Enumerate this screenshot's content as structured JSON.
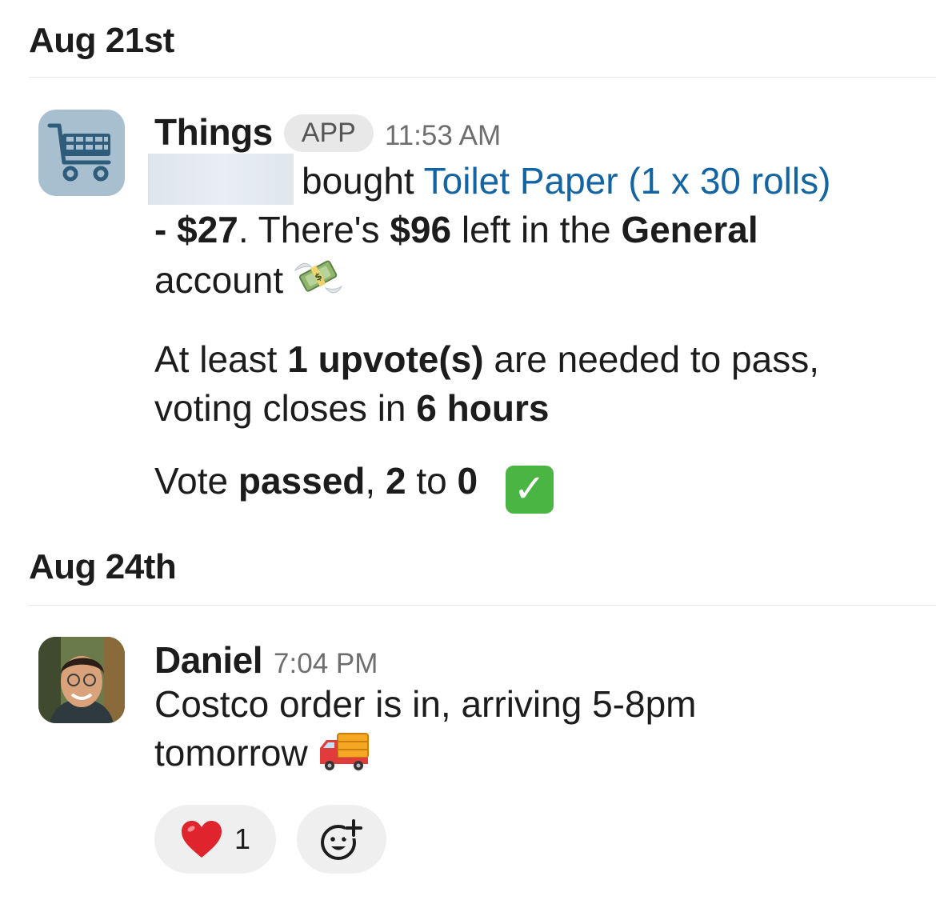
{
  "sections": [
    {
      "date": "Aug 21st",
      "message": {
        "sender": "Things",
        "badge": "APP",
        "time": "11:53 AM",
        "avatar_icon": "shopping-cart-icon",
        "line1_verb": "bought",
        "item_link": "Toilet Paper (1 x 30 rolls)",
        "price_prefix": "- ",
        "price": "$27",
        "sentence2_a": ". There's ",
        "amount_left": "$96",
        "sentence2_b": " left in the ",
        "account_name": "General",
        "sentence2_c": "account",
        "money_emoji": "money-with-wings-emoji",
        "vote_a": "At least ",
        "vote_needed": "1 upvote(s)",
        "vote_b": " are needed to pass, voting closes in ",
        "vote_time": "6 hours",
        "result_a": "Vote ",
        "result_status": "passed",
        "result_b": ", ",
        "result_yes": "2",
        "result_c": " to ",
        "result_no": "0",
        "check_emoji": "check-mark-button-emoji"
      }
    },
    {
      "date": "Aug 24th",
      "message": {
        "sender": "Daniel",
        "time": "7:04 PM",
        "text": "Costco order is in, arriving 5-8pm tomorrow",
        "truck_emoji": "delivery-truck-emoji",
        "reactions": [
          {
            "emoji": "heart-emoji",
            "count": "1"
          },
          {
            "emoji": "add-reaction-icon"
          }
        ]
      }
    }
  ],
  "colors": {
    "link": "#1264a3",
    "check_green": "#4bb543",
    "heart_red": "#e0242e"
  }
}
